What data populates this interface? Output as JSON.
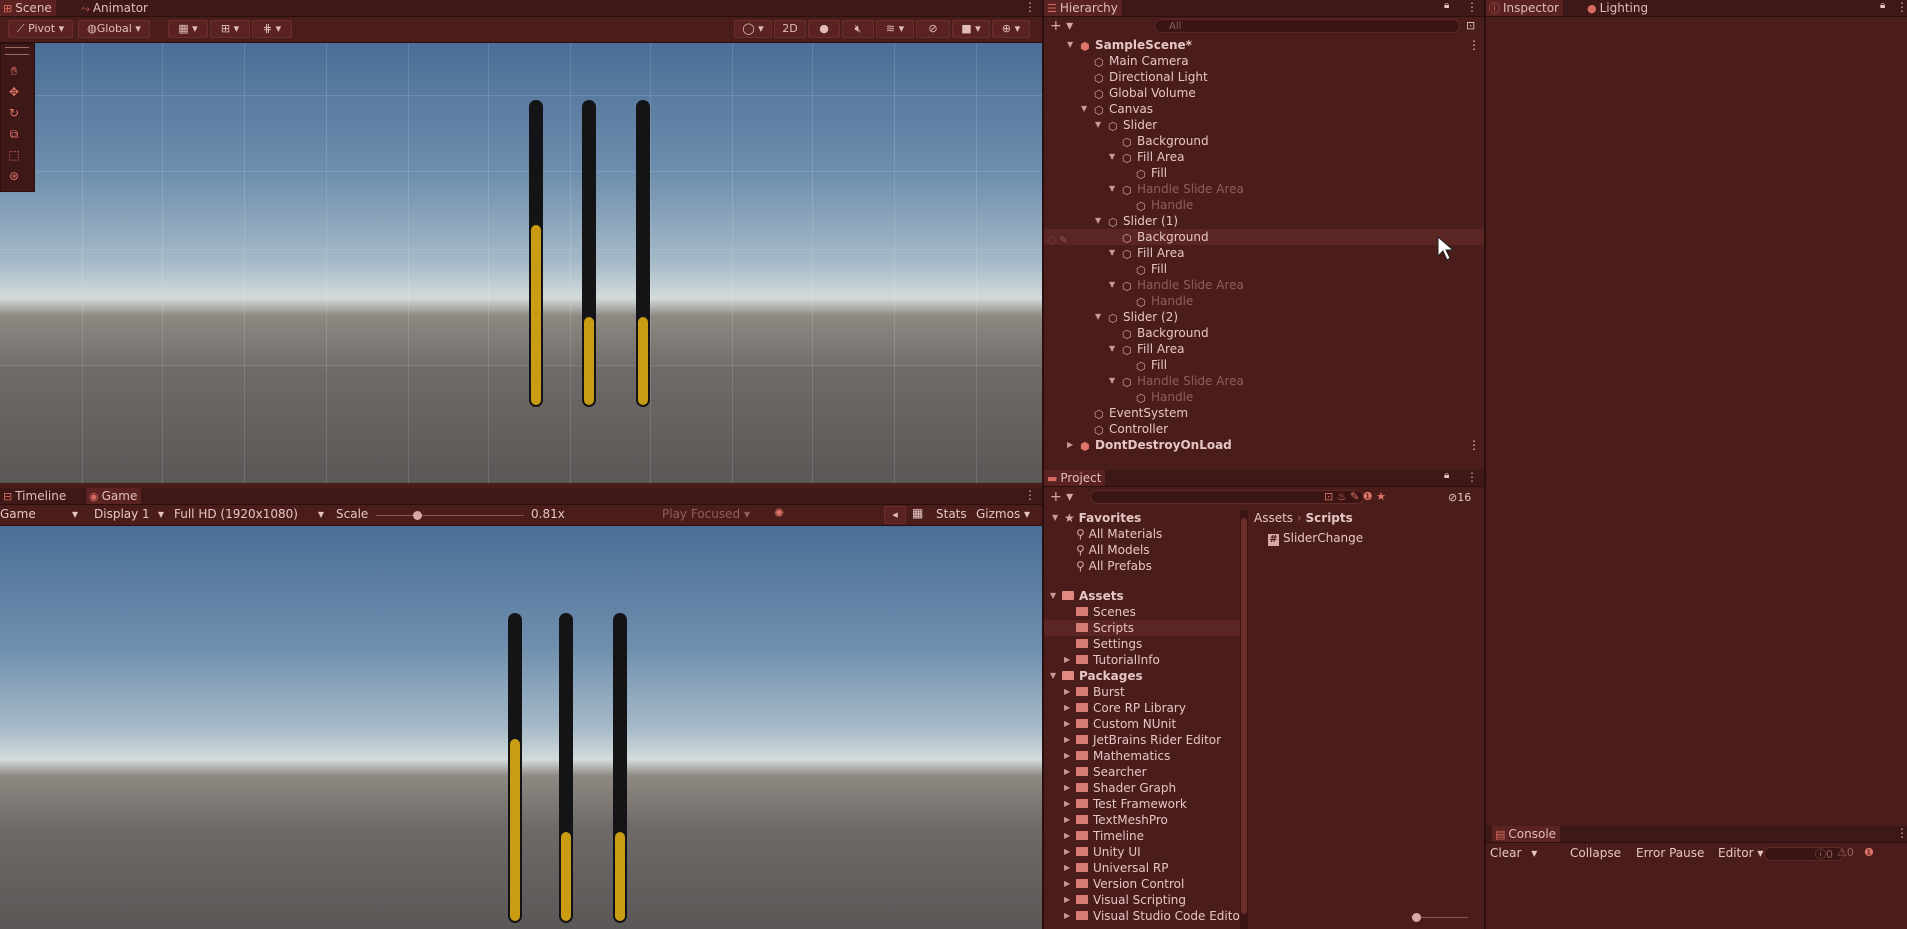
{
  "scene_tabs": {
    "scene": "Scene",
    "animator": "Animator"
  },
  "scene_toolbar": {
    "pivot": "Pivot",
    "global": "Global",
    "mode_2d": "2D"
  },
  "game_tabs": {
    "timeline": "Timeline",
    "game": "Game"
  },
  "game_toolbar": {
    "view": "Game",
    "display": "Display 1",
    "resolution": "Full HD (1920x1080)",
    "scale_label": "Scale",
    "scale_value": "0.81x",
    "scale_fraction": 0.28,
    "play_focused": "Play Focused",
    "stats": "Stats",
    "gizmos": "Gizmos"
  },
  "sliders": [
    {
      "value": 0.6
    },
    {
      "value": 0.3
    },
    {
      "value": 0.3
    }
  ],
  "hierarchy": {
    "title": "Hierarchy",
    "search_placeholder": "All",
    "items": [
      {
        "label": "SampleScene*",
        "depth": 0,
        "type": "scene",
        "expanded": true,
        "dim": false
      },
      {
        "label": "Main Camera",
        "depth": 1,
        "type": "object",
        "dim": false
      },
      {
        "label": "Directional Light",
        "depth": 1,
        "type": "object",
        "dim": false
      },
      {
        "label": "Global Volume",
        "depth": 1,
        "type": "object",
        "dim": false
      },
      {
        "label": "Canvas",
        "depth": 1,
        "type": "object",
        "expanded": true,
        "dim": false
      },
      {
        "label": "Slider",
        "depth": 2,
        "type": "object",
        "expanded": true,
        "dim": false
      },
      {
        "label": "Background",
        "depth": 3,
        "type": "object",
        "dim": false
      },
      {
        "label": "Fill Area",
        "depth": 3,
        "type": "object",
        "expanded": true,
        "dim": false
      },
      {
        "label": "Fill",
        "depth": 4,
        "type": "object",
        "dim": false
      },
      {
        "label": "Handle Slide Area",
        "depth": 3,
        "type": "object",
        "expanded": true,
        "dim": true
      },
      {
        "label": "Handle",
        "depth": 4,
        "type": "object",
        "dim": true
      },
      {
        "label": "Slider (1)",
        "depth": 2,
        "type": "object",
        "expanded": true,
        "dim": false
      },
      {
        "label": "Background",
        "depth": 3,
        "type": "object",
        "dim": false,
        "hover": true
      },
      {
        "label": "Fill Area",
        "depth": 3,
        "type": "object",
        "expanded": true,
        "dim": false
      },
      {
        "label": "Fill",
        "depth": 4,
        "type": "object",
        "dim": false
      },
      {
        "label": "Handle Slide Area",
        "depth": 3,
        "type": "object",
        "expanded": true,
        "dim": true
      },
      {
        "label": "Handle",
        "depth": 4,
        "type": "object",
        "dim": true
      },
      {
        "label": "Slider (2)",
        "depth": 2,
        "type": "object",
        "expanded": true,
        "dim": false
      },
      {
        "label": "Background",
        "depth": 3,
        "type": "object",
        "dim": false
      },
      {
        "label": "Fill Area",
        "depth": 3,
        "type": "object",
        "expanded": true,
        "dim": false
      },
      {
        "label": "Fill",
        "depth": 4,
        "type": "object",
        "dim": false
      },
      {
        "label": "Handle Slide Area",
        "depth": 3,
        "type": "object",
        "expanded": true,
        "dim": true
      },
      {
        "label": "Handle",
        "depth": 4,
        "type": "object",
        "dim": true
      },
      {
        "label": "EventSystem",
        "depth": 1,
        "type": "object",
        "dim": false
      },
      {
        "label": "Controller",
        "depth": 1,
        "type": "object",
        "dim": false
      },
      {
        "label": "DontDestroyOnLoad",
        "depth": 0,
        "type": "scene",
        "expanded": false,
        "dim": false
      }
    ]
  },
  "project": {
    "title": "Project",
    "hidden_count": "16",
    "favorites_label": "Favorites",
    "favorites": [
      "All Materials",
      "All Models",
      "All Prefabs"
    ],
    "assets_label": "Assets",
    "assets": [
      {
        "label": "Scenes",
        "arrow": false,
        "selected": false
      },
      {
        "label": "Scripts",
        "arrow": false,
        "selected": true
      },
      {
        "label": "Settings",
        "arrow": false,
        "selected": false
      },
      {
        "label": "TutorialInfo",
        "arrow": true,
        "selected": false
      }
    ],
    "packages_label": "Packages",
    "packages": [
      "Burst",
      "Core RP Library",
      "Custom NUnit",
      "JetBrains Rider Editor",
      "Mathematics",
      "Searcher",
      "Shader Graph",
      "Test Framework",
      "TextMeshPro",
      "Timeline",
      "Unity UI",
      "Universal RP",
      "Version Control",
      "Visual Scripting",
      "Visual Studio Code Editor"
    ],
    "breadcrumb": {
      "root": "Assets",
      "current": "Scripts"
    },
    "files": [
      "SliderChange"
    ]
  },
  "inspector": {
    "inspector_tab": "Inspector",
    "lighting_tab": "Lighting"
  },
  "console": {
    "title": "Console",
    "clear": "Clear",
    "collapse": "Collapse",
    "error_pause": "Error Pause",
    "editor": "Editor",
    "count_info": "0",
    "count_warn": "0"
  }
}
